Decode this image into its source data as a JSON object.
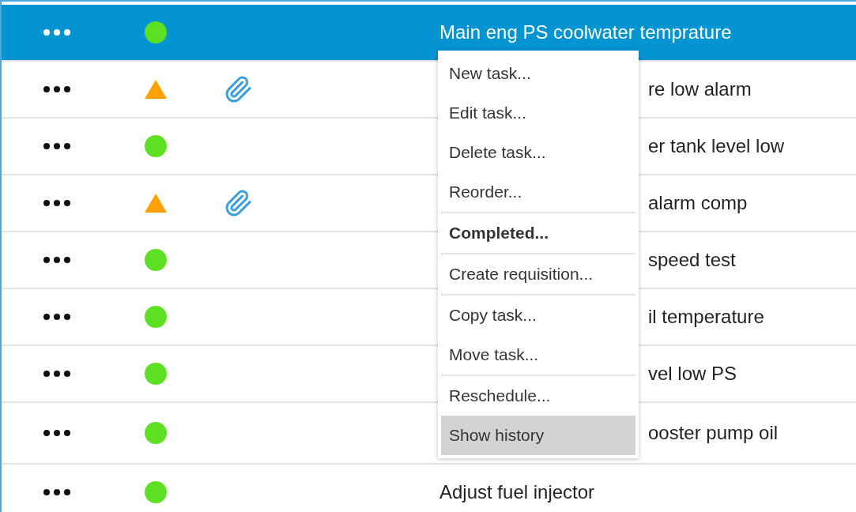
{
  "rows": [
    {
      "selected": true,
      "kind": "ok",
      "attachment": false,
      "title": "Main eng PS coolwater temprature"
    },
    {
      "selected": false,
      "kind": "warning",
      "attachment": true,
      "covered": true,
      "title": "re low alarm"
    },
    {
      "selected": false,
      "kind": "ok",
      "attachment": false,
      "covered": true,
      "title": "er tank level low"
    },
    {
      "selected": false,
      "kind": "warning",
      "attachment": true,
      "covered": true,
      "title": "alarm comp"
    },
    {
      "selected": false,
      "kind": "ok",
      "attachment": false,
      "covered": true,
      "title": "speed test"
    },
    {
      "selected": false,
      "kind": "ok",
      "attachment": false,
      "covered": true,
      "title": "il temperature"
    },
    {
      "selected": false,
      "kind": "ok",
      "attachment": false,
      "covered": true,
      "title": "vel low PS"
    },
    {
      "selected": false,
      "kind": "ok",
      "attachment": false,
      "covered": true,
      "title": "ooster pump oil"
    },
    {
      "selected": false,
      "kind": "ok",
      "attachment": false,
      "title": "Adjust fuel injector"
    }
  ],
  "context_menu": {
    "groups": [
      [
        {
          "label": "New task...",
          "kind": "normal",
          "selected": false
        },
        {
          "label": "Edit task...",
          "kind": "normal",
          "selected": false
        },
        {
          "label": "Delete task...",
          "kind": "normal",
          "selected": false
        },
        {
          "label": "Reorder...",
          "kind": "normal",
          "selected": false
        }
      ],
      [
        {
          "label": "Completed...",
          "kind": "default",
          "selected": false
        }
      ],
      [
        {
          "label": "Create requisition...",
          "kind": "normal",
          "selected": false
        }
      ],
      [
        {
          "label": "Copy task...",
          "kind": "normal",
          "selected": false
        },
        {
          "label": "Move task...",
          "kind": "normal",
          "selected": false
        }
      ],
      [
        {
          "label": "Reschedule...",
          "kind": "normal",
          "selected": false
        },
        {
          "label": "Show history",
          "kind": "normal",
          "selected": true
        }
      ]
    ]
  }
}
